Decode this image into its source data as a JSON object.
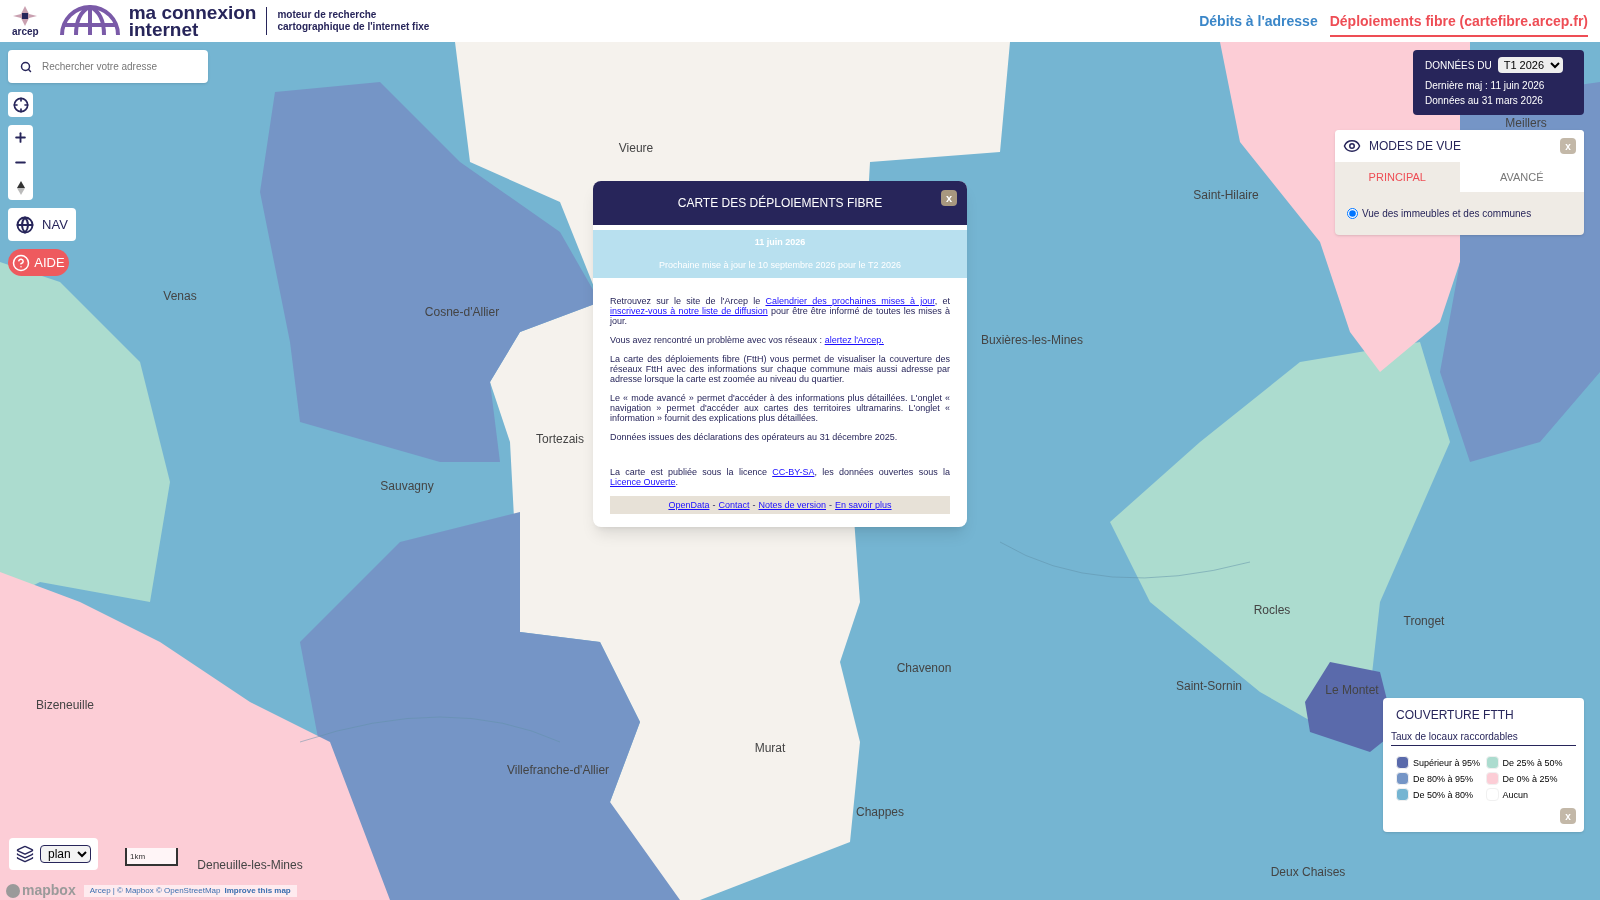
{
  "header": {
    "logo_text": "arcep",
    "brand_lines": [
      "ma connexion",
      "internet"
    ],
    "tagline_lines": [
      "moteur de recherche",
      "cartographique de l'internet fixe"
    ],
    "nav_links": [
      {
        "label": "Débits à l'adresse",
        "selected": false
      },
      {
        "label": "Déploiements fibre (cartefibre.arcep.fr)",
        "selected": true
      }
    ]
  },
  "search": {
    "placeholder": "Rechercher votre adresse"
  },
  "map_buttons": {
    "nav": "NAV",
    "help": "AIDE"
  },
  "data_panel": {
    "label": "DONNÉES DU",
    "period": "T1 2026",
    "lines": [
      "Dernière maj : 11 juin 2026",
      "Données au 31 mars 2026"
    ]
  },
  "view_modes": {
    "title": "MODES DE VUE",
    "close": "x",
    "tabs": [
      {
        "label": "PRINCIPAL",
        "selected": true
      },
      {
        "label": "AVANCÉ",
        "selected": false
      }
    ],
    "options": [
      {
        "label": "Vue des immeubles et des communes",
        "selected": true
      }
    ]
  },
  "modal": {
    "title": "CARTE DES DÉPLOIEMENTS FIBRE",
    "close": "x",
    "date": "11 juin 2026",
    "next_update": "Prochaine mise à jour le 10 septembre 2026 pour le T2 2026",
    "paragraphs": [
      [
        {
          "text": "Retrouvez sur le site de l'Arcep le "
        },
        {
          "text": "Calendrier des prochaines mises à jour",
          "link": true
        },
        {
          "text": ", et "
        },
        {
          "text": "inscrivez-vous à notre liste de diffusion",
          "link": true
        },
        {
          "text": " pour être être informé de toutes les mises à jour."
        }
      ],
      [
        {
          "text": "Vous avez rencontré un problème avec vos réseaux : "
        },
        {
          "text": "alertez l'Arcep.",
          "link": true
        }
      ],
      [
        {
          "text": "La carte des déploiements fibre (FttH) vous permet de visualiser la couverture des réseaux FttH avec des informations sur chaque commune mais aussi adresse par adresse lorsque la carte est zoomée au niveau du quartier."
        }
      ],
      [
        {
          "text": "Le « mode avancé » permet d'accéder à des informations plus détaillées. L'onglet « navigation » permet d'accéder aux cartes des territoires ultramarins. L'onglet « information » fournit des explications plus détaillées."
        }
      ],
      [
        {
          "text": "Données issues des déclarations des opérateurs au 31 décembre 2025."
        }
      ],
      [
        {
          "text": "La carte est publiée sous la licence "
        },
        {
          "text": "CC-BY-SA",
          "link": true
        },
        {
          "text": ", les données ouvertes sous la "
        },
        {
          "text": "Licence Ouverte",
          "link": true
        },
        {
          "text": "."
        }
      ]
    ],
    "footer_links": [
      "OpenData",
      "Contact",
      "Notes de version",
      "En savoir plus"
    ],
    "footer_separator": "-"
  },
  "legend": {
    "title": "COUVERTURE FTTH",
    "subtitle": "Taux de locaux raccordables",
    "close": "x",
    "items": [
      {
        "label": "Supérieur à 95%",
        "color": "#5a6aab"
      },
      {
        "label": "De 80% à 95%",
        "color": "#7595c6"
      },
      {
        "label": "De 50% à 80%",
        "color": "#75b5d2"
      },
      {
        "label": "De 25% à 50%",
        "color": "#acdccf"
      },
      {
        "label": "De 0% à 25%",
        "color": "#fccdd6"
      },
      {
        "label": "Aucun",
        "color": "#ffffff"
      }
    ]
  },
  "map_footer": {
    "layer": "plan",
    "scale": "1km",
    "mapbox_logo": "mapbox",
    "attribution": "Arcep | © Mapbox © OpenStreetMap",
    "improve": "Improve this map"
  },
  "places": [
    "Vieure",
    "Venas",
    "Cosne-d'Allier",
    "Tortezais",
    "Sauvagny",
    "Buxières-les-Mines",
    "Saint-Hilaire",
    "Meillers",
    "Rocles",
    "Tronget",
    "Saint-Sornin",
    "Le Montet",
    "Chavenon",
    "Murat",
    "Villefranche-d'Allier",
    "Chappes",
    "Bizeneuille",
    "Deneuille-les-Mines",
    "Deux Chaises"
  ]
}
